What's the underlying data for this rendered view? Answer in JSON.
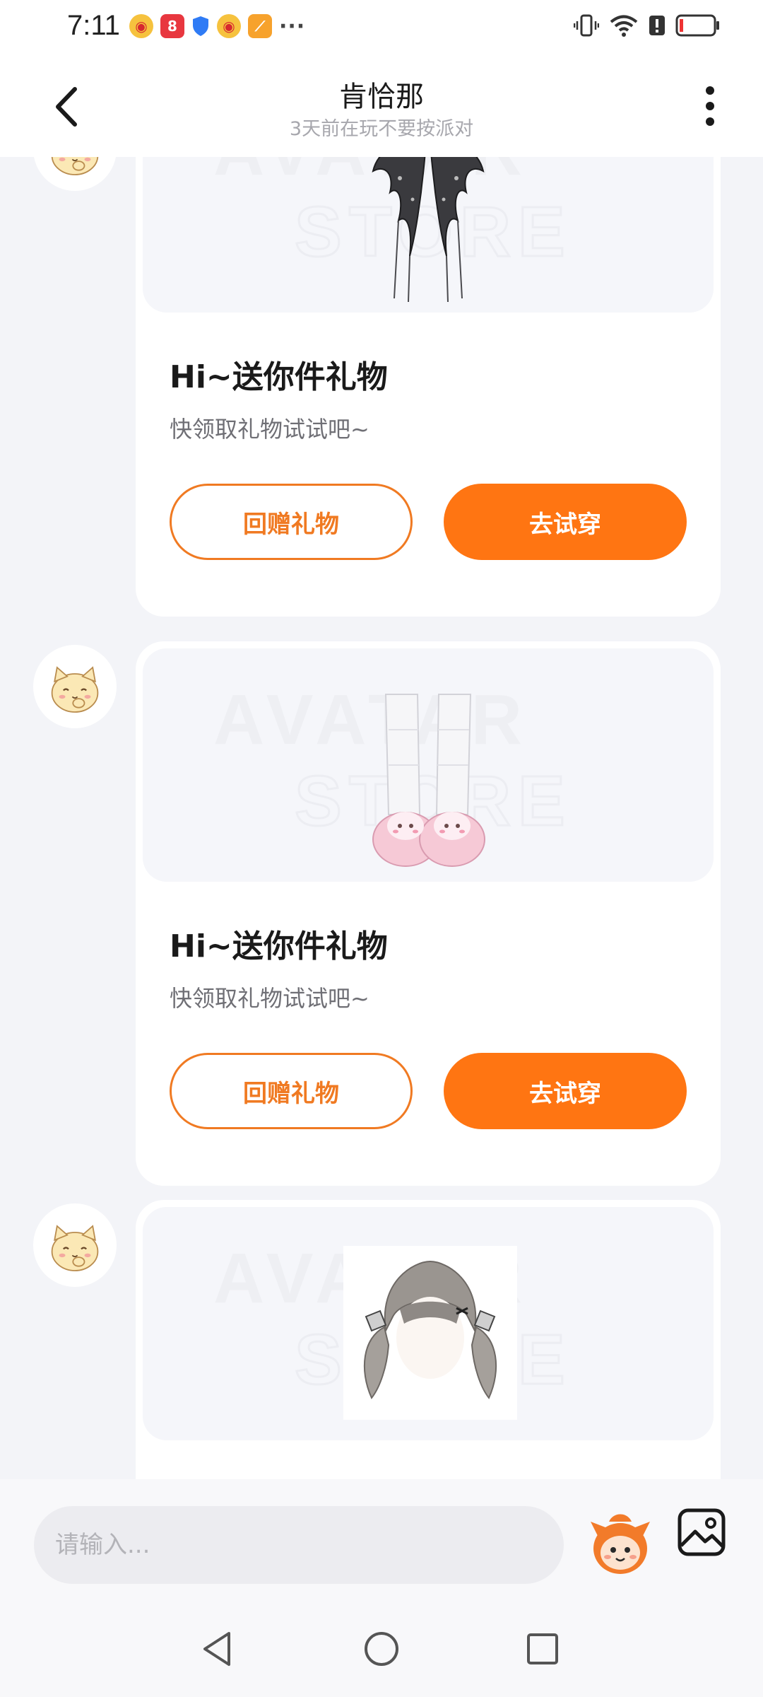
{
  "status_bar": {
    "time": "7:11",
    "more_notifications": "···"
  },
  "header": {
    "title": "肯恰那",
    "subtitle": "3天前在玩不要按派对"
  },
  "messages": [
    {
      "item_icon": "bat-wings-accessory",
      "title": "Hi~送你件礼物",
      "desc": "快领取礼物试试吧~",
      "return_gift_label": "回赠礼物",
      "try_on_label": "去试穿"
    },
    {
      "item_icon": "leg-warmers-bunny-slippers",
      "title": "Hi~送你件礼物",
      "desc": "快领取礼物试试吧~",
      "return_gift_label": "回赠礼物",
      "try_on_label": "去试穿"
    },
    {
      "item_icon": "twin-tail-hairstyle"
    }
  ],
  "input": {
    "placeholder": "请输入..."
  },
  "colors": {
    "accent": "#ff7512",
    "outline": "#f07a22",
    "background": "#f3f4f8"
  }
}
